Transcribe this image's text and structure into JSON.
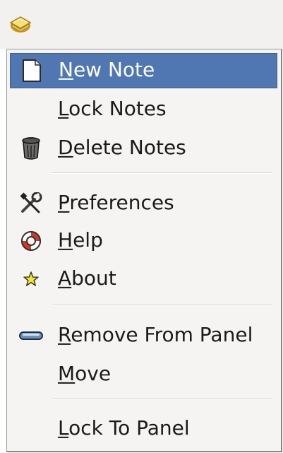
{
  "panel": {
    "applet_icon": "tomboy-notes-icon"
  },
  "menu": {
    "items": [
      {
        "id": "new-note",
        "mnemonic": "N",
        "rest": "ew Note",
        "icon": "new-note-icon",
        "active": true
      },
      {
        "id": "lock-notes",
        "mnemonic": "L",
        "rest": "ock Notes",
        "icon": null
      },
      {
        "id": "delete-notes",
        "mnemonic": "D",
        "rest": "elete Notes",
        "icon": "trash-icon"
      },
      {
        "id": "preferences",
        "mnemonic": "P",
        "rest": "references",
        "icon": "preferences-icon"
      },
      {
        "id": "help",
        "mnemonic": "H",
        "rest": "elp",
        "icon": "help-icon"
      },
      {
        "id": "about",
        "mnemonic": "A",
        "rest": "bout",
        "icon": "star-icon"
      },
      {
        "id": "remove-from-panel",
        "mnemonic": "R",
        "rest": "emove From Panel",
        "icon": "remove-icon"
      },
      {
        "id": "move",
        "mnemonic": "M",
        "rest": "ove",
        "icon": null
      },
      {
        "id": "lock-to-panel",
        "mnemonic": "L",
        "rest": "ock To Panel",
        "icon": null
      }
    ]
  },
  "colors": {
    "highlight": "#5077b2",
    "menu_bg": "#f5f4f3"
  }
}
